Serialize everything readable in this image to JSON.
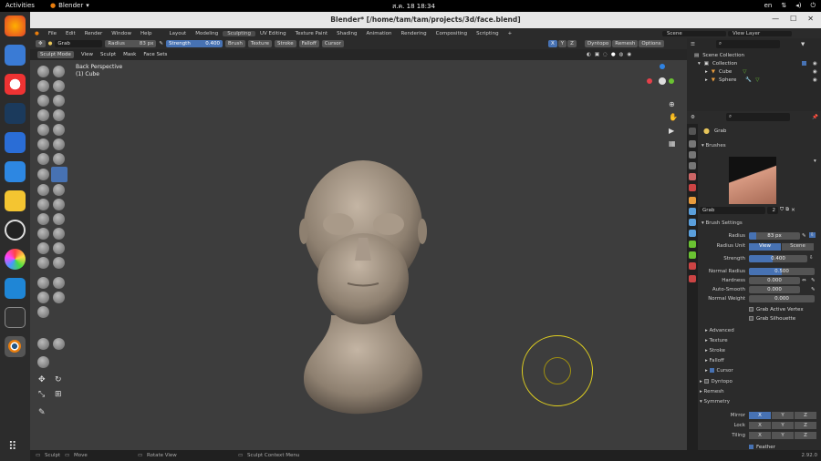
{
  "topbar": {
    "activities": "Activities",
    "app": "Blender",
    "clock": "ส.ค. 18  18:34",
    "lang": "en"
  },
  "window": {
    "title": "Blender* [/home/tam/tam/projects/3d/face.blend]"
  },
  "menus": [
    "File",
    "Edit",
    "Render",
    "Window",
    "Help"
  ],
  "workspaces": [
    "Layout",
    "Modeling",
    "Sculpting",
    "UV Editing",
    "Texture Paint",
    "Shading",
    "Animation",
    "Rendering",
    "Compositing",
    "Scripting"
  ],
  "active_workspace": "Sculpting",
  "scene": "Scene",
  "view_layer": "View Layer",
  "tool": {
    "name": "Grab",
    "radius_label": "Radius",
    "radius": "83 px",
    "strength_label": "Strength",
    "strength": "0.400",
    "dropdowns": [
      "Brush",
      "Texture",
      "Stroke",
      "Falloff",
      "Cursor"
    ],
    "x": "X",
    "y": "Y",
    "z": "Z",
    "dyntopo": "Dyntopo",
    "remesh": "Remesh",
    "options": "Options"
  },
  "mode": {
    "label": "Sculpt Mode",
    "items": [
      "View",
      "Sculpt",
      "Mask",
      "Face Sets"
    ]
  },
  "viewport": {
    "perspective": "Back Perspective",
    "object": "(1) Cube"
  },
  "outliner": {
    "scene_collection": "Scene Collection",
    "collection": "Collection",
    "objects": [
      "Cube",
      "Sphere"
    ]
  },
  "props": {
    "brush": "Grab",
    "brushes": "Brushes",
    "brush_name": "Grab",
    "users": "2",
    "brush_settings": "Brush Settings",
    "radius_label": "Radius",
    "radius": "83 px",
    "radius_unit_label": "Radius Unit",
    "view": "View",
    "scene": "Scene",
    "strength_label": "Strength",
    "strength": "0.400",
    "strength_frac": 0.4,
    "normal_radius_label": "Normal Radius",
    "normal_radius": "0.500",
    "normal_radius_frac": 0.5,
    "hardness_label": "Hardness",
    "hardness": "0.000",
    "autosmooth_label": "Auto-Smooth",
    "autosmooth": "0.000",
    "normal_weight_label": "Normal Weight",
    "normal_weight": "0.000",
    "grab_active_vertex": "Grab Active Vertex",
    "grab_silhouette": "Grab Silhouette",
    "sections": [
      "Advanced",
      "Texture",
      "Stroke",
      "Falloff",
      "Cursor"
    ],
    "dyntopo": "Dyntopo",
    "remesh": "Remesh",
    "symmetry": "Symmetry",
    "mirror": "Mirror",
    "lock": "Lock",
    "tiling": "Tiling",
    "x": "X",
    "y": "Y",
    "z": "Z",
    "feather": "Feather"
  },
  "status": {
    "sculpt": "Sculpt",
    "move": "Move",
    "rotate": "Rotate View",
    "context": "Sculpt Context Menu",
    "version": "2.92.0"
  },
  "colors": {
    "accent": "#4772b3",
    "viewport": "#3d3d3d",
    "panel": "#2b2b2b"
  }
}
